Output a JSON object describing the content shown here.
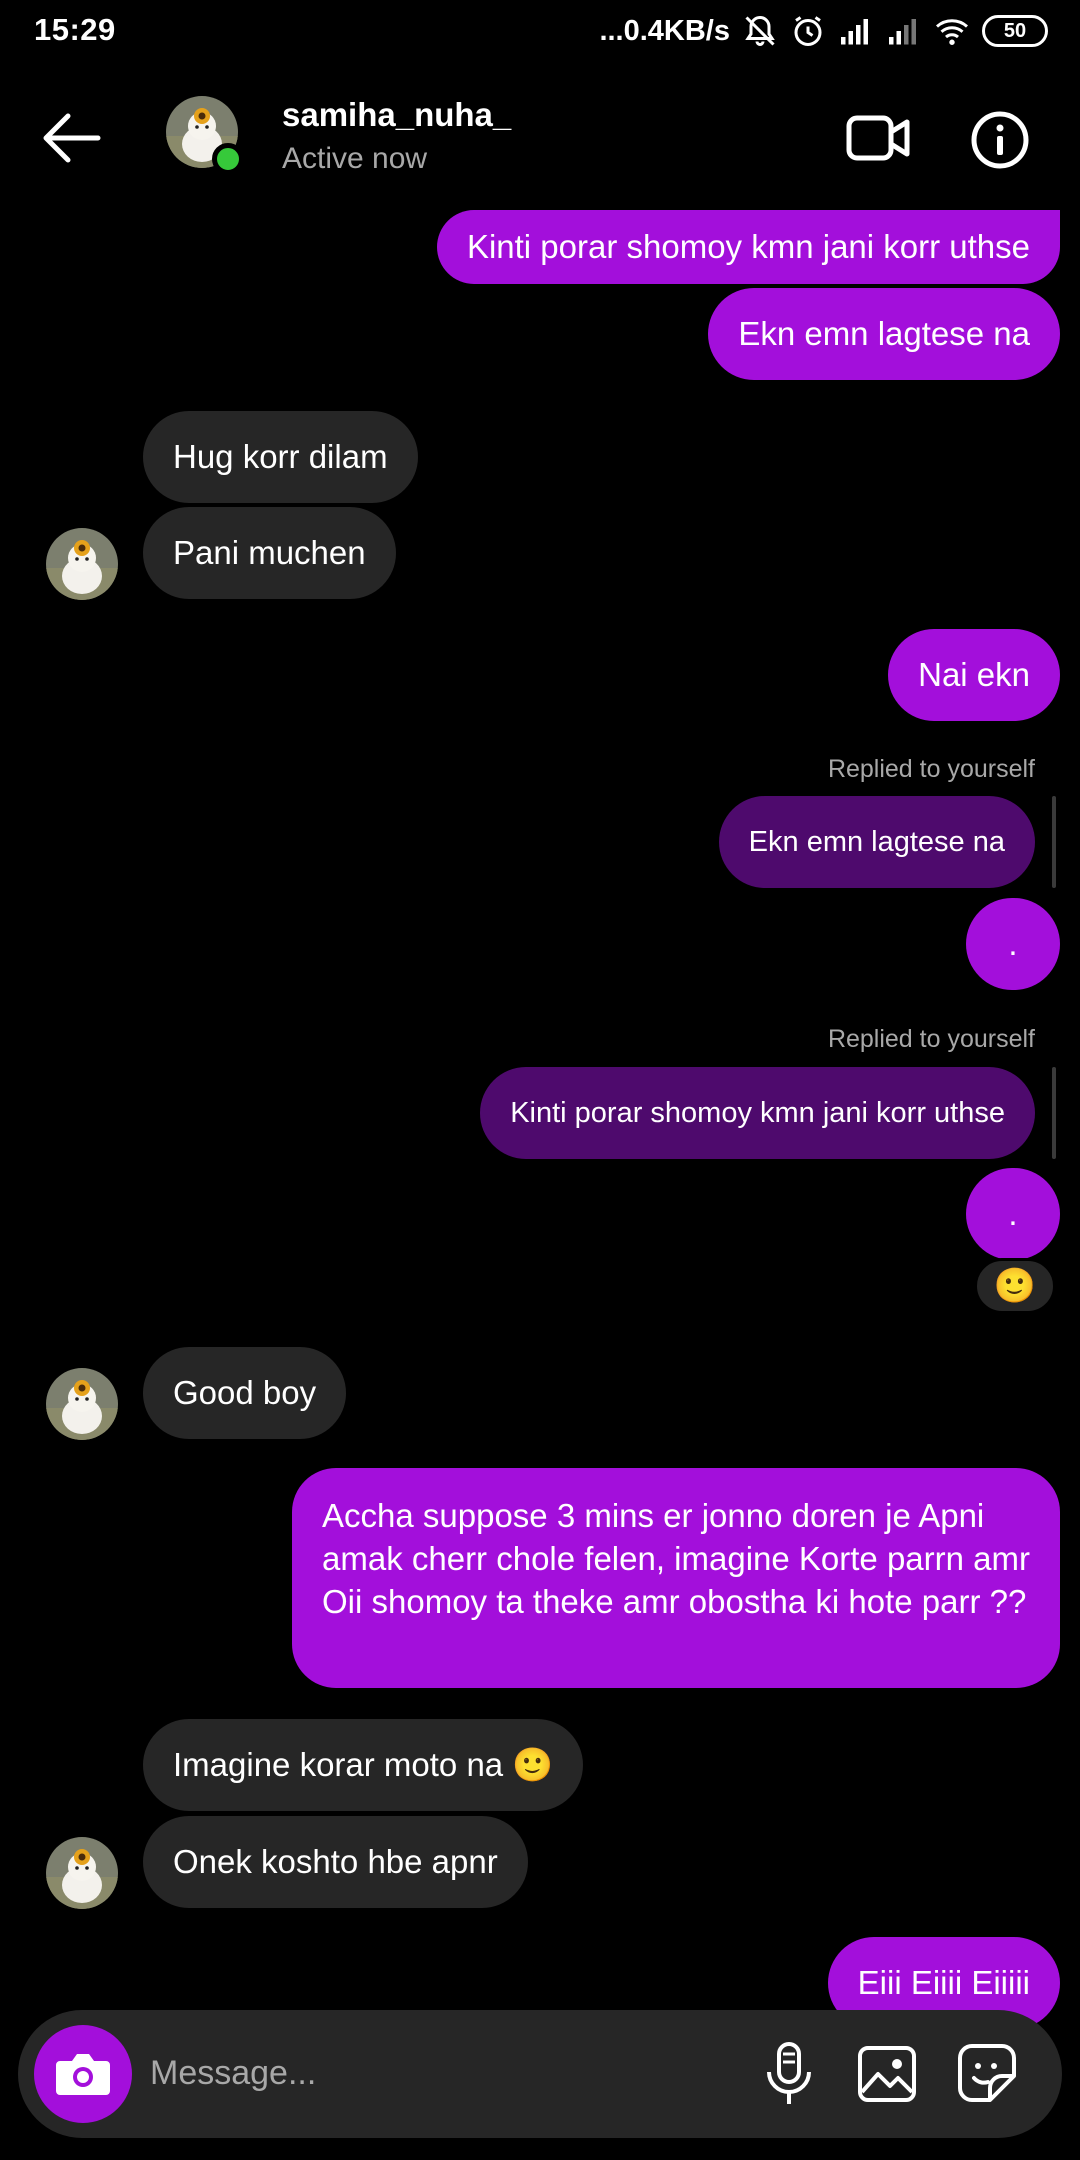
{
  "status_bar": {
    "time": "15:29",
    "net_speed": "...0.4KB/s",
    "battery": "50"
  },
  "header": {
    "username": "samiha_nuha_",
    "active_status": "Active now"
  },
  "messages": [
    {
      "text": "Kinti porar shomoy kmn jani korr uthse",
      "sender": "me"
    },
    {
      "text": "Ekn emn lagtese na",
      "sender": "me"
    },
    {
      "text": "Hug korr dilam",
      "sender": "them"
    },
    {
      "text": "Pani muchen",
      "sender": "them"
    },
    {
      "text": "Nai ekn",
      "sender": "me"
    },
    {
      "reply_label": "Replied to yourself",
      "quoted": "Ekn emn lagtese na",
      "text": ".",
      "sender": "me"
    },
    {
      "reply_label": "Replied to yourself",
      "quoted": "Kinti porar shomoy kmn jani korr uthse",
      "text": ".",
      "sender": "me",
      "reaction": "🙂"
    },
    {
      "text": "Good boy",
      "sender": "them"
    },
    {
      "text": "Accha suppose 3 mins er jonno doren je Apni amak cherr chole felen, imagine Korte parrn amr Oii shomoy ta theke amr obostha ki hote parr ??",
      "sender": "me"
    },
    {
      "text": "Imagine korar moto na 🙂",
      "sender": "them"
    },
    {
      "text": "Onek koshto hbe apnr",
      "sender": "them"
    },
    {
      "text": "Eiii Eiiii Eiiiii",
      "sender": "me"
    }
  ],
  "composer": {
    "placeholder": "Message..."
  },
  "colors": {
    "outgoing_bubble": "#a30fdb",
    "incoming_bubble": "#262626",
    "reply_bubble": "#4e0a6d",
    "online_dot": "#36c93a"
  },
  "icons": [
    "back-arrow-icon",
    "video-call-icon",
    "info-icon",
    "camera-icon",
    "microphone-icon",
    "gallery-icon",
    "sticker-icon",
    "silent-bell-icon",
    "alarm-icon",
    "signal-icon",
    "wifi-icon"
  ]
}
